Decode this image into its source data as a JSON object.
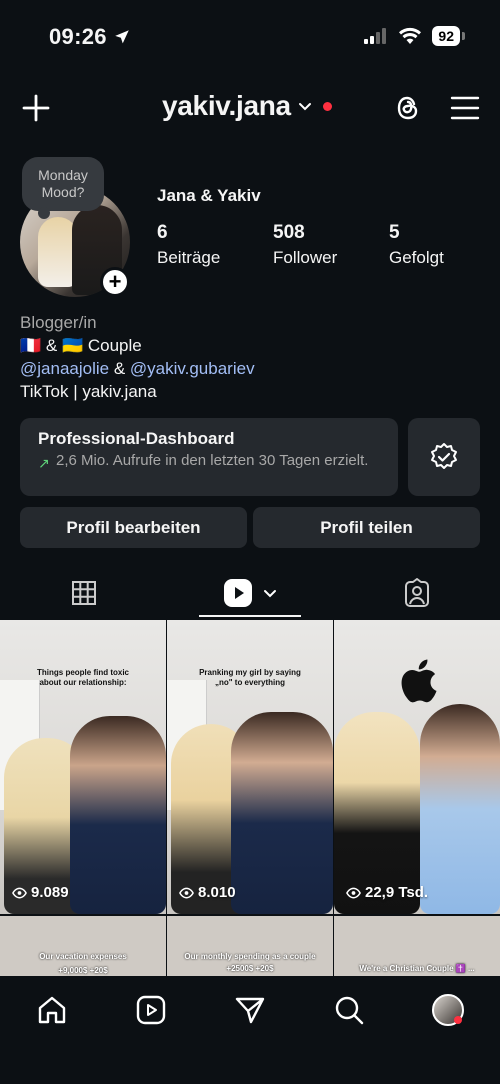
{
  "status_bar": {
    "time": "09:26",
    "battery": "92"
  },
  "header": {
    "username": "yakiv.jana"
  },
  "profile": {
    "note": "Monday Mood?",
    "display_name": "Jana & Yakiv",
    "stats": [
      {
        "value": "6",
        "label": "Beiträge"
      },
      {
        "value": "508",
        "label": "Follower"
      },
      {
        "value": "5",
        "label": "Gefolgt"
      }
    ],
    "bio": {
      "category": "Blogger/in",
      "line1_flags": "🇫🇷 & 🇺🇦",
      "line1_text": "Couple",
      "mention1": "@janaajolie",
      "amp": "&",
      "mention2": "@yakiv.gubariev",
      "line3": "TikTok | yakiv.jana"
    }
  },
  "dashboard": {
    "title": "Professional-Dashboard",
    "subtitle": "2,6 Mio. Aufrufe in den letzten 30 Tagen erzielt."
  },
  "buttons": {
    "edit": "Profil bearbeiten",
    "share": "Profil teilen"
  },
  "grid": {
    "items": [
      {
        "caption": "Things people find toxic about our relationship:",
        "views": "9.089"
      },
      {
        "caption": "Pranking my girl by saying „no\" to everything",
        "views": "8.010"
      },
      {
        "caption": "",
        "views": "22,9 Tsd."
      },
      {
        "caption": "Our vacation expenses",
        "sub": "+9,000$   +20$",
        "views": ""
      },
      {
        "caption": "Our monthly spending as a couple",
        "sub": "+2500$   +20$",
        "views": ""
      },
      {
        "caption": "We're a Christian Couple ✝️ ...",
        "views": ""
      }
    ]
  },
  "colors": {
    "background": "#0c1014",
    "surface": "#25292e",
    "link": "#a3bef5",
    "notification": "#ff3040"
  }
}
